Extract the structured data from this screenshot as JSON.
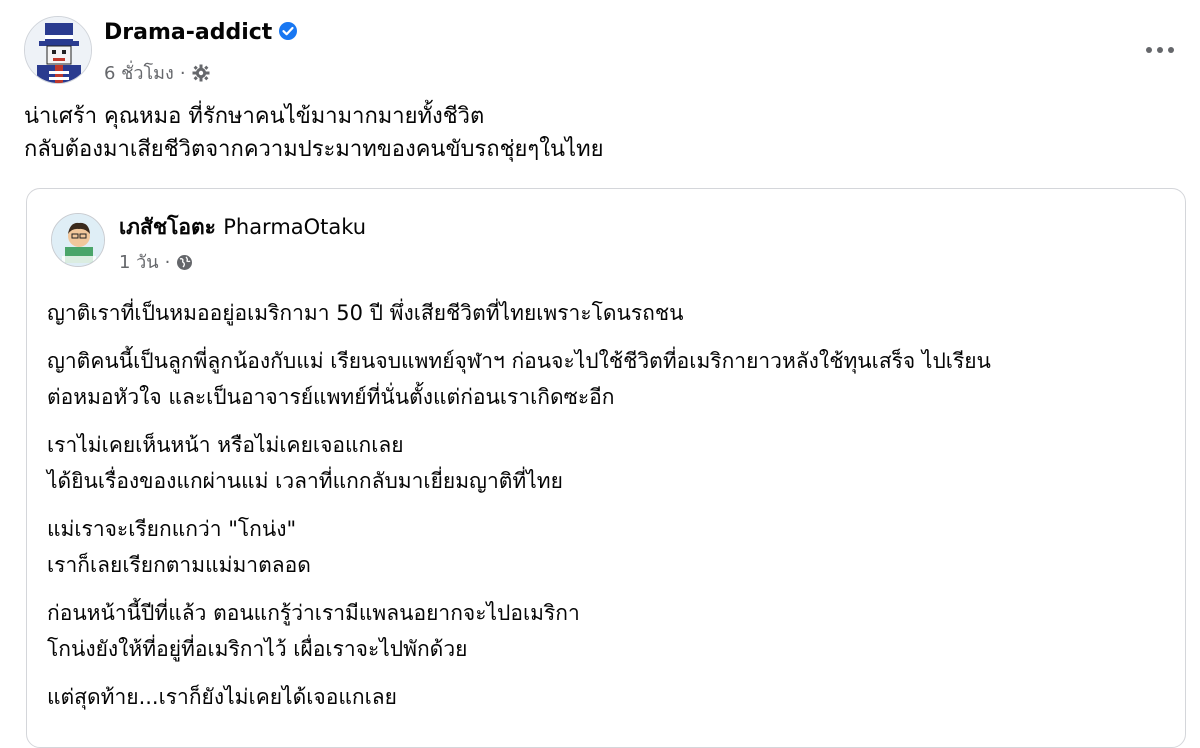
{
  "post": {
    "author": "Drama-addict",
    "verified_icon": "verified-badge-icon",
    "time": "6 ชั่วโมง",
    "separator": "·",
    "privacy_icon": "settings-gear-icon",
    "more_icon": "more-options-icon",
    "text_lines": [
      "น่าเศร้า คุณหมอ ที่รักษาคนไข้มามากมายทั้งชีวิต",
      "กลับต้องมาเสียชีวิตจากความประมาทของคนขับรถชุ่ยๆในไทย"
    ]
  },
  "shared": {
    "author_thai": "เภสัชโอตะ",
    "author_latin": "PharmaOtaku",
    "time": "1 วัน",
    "separator": "·",
    "privacy_icon": "globe-icon",
    "paragraphs": [
      [
        "ญาติเราที่เป็นหมออยู่อเมริกามา 50 ปี พึ่งเสียชีวิตที่ไทยเพราะโดนรถชน"
      ],
      [
        "ญาติคนนี้เป็นลูกพี่ลูกน้องกับแม่ เรียนจบแพทย์จุฬาฯ ก่อนจะไปใช้ชีวิตที่อเมริกายาวหลังใช้ทุนเสร็จ ไปเรียน",
        "ต่อหมอหัวใจ และเป็นอาจารย์แพทย์ที่นั่นตั้งแต่ก่อนเราเกิดซะอีก"
      ],
      [
        "เราไม่เคยเห็นหน้า หรือไม่เคยเจอแกเลย",
        "ได้ยินเรื่องของแกผ่านแม่ เวลาที่แกกลับมาเยี่ยมญาติที่ไทย"
      ],
      [
        "แม่เราจะเรียกแกว่า \"โกน่ง\"",
        "เราก็เลยเรียกตามแม่มาตลอด"
      ],
      [
        "ก่อนหน้านี้ปีที่แล้ว ตอนแกรู้ว่าเรามีแพลนอยากจะไปอเมริกา",
        "โกน่งยังให้ที่อยู่ที่อเมริกาไว้ เผื่อเราจะไปพักด้วย"
      ],
      [
        "แต่สุดท้าย...เราก็ยังไม่เคยได้เจอแกเลย"
      ]
    ]
  },
  "colors": {
    "verified": "#1877f2",
    "secondary_text": "#65676b",
    "border": "#d4d6da"
  }
}
